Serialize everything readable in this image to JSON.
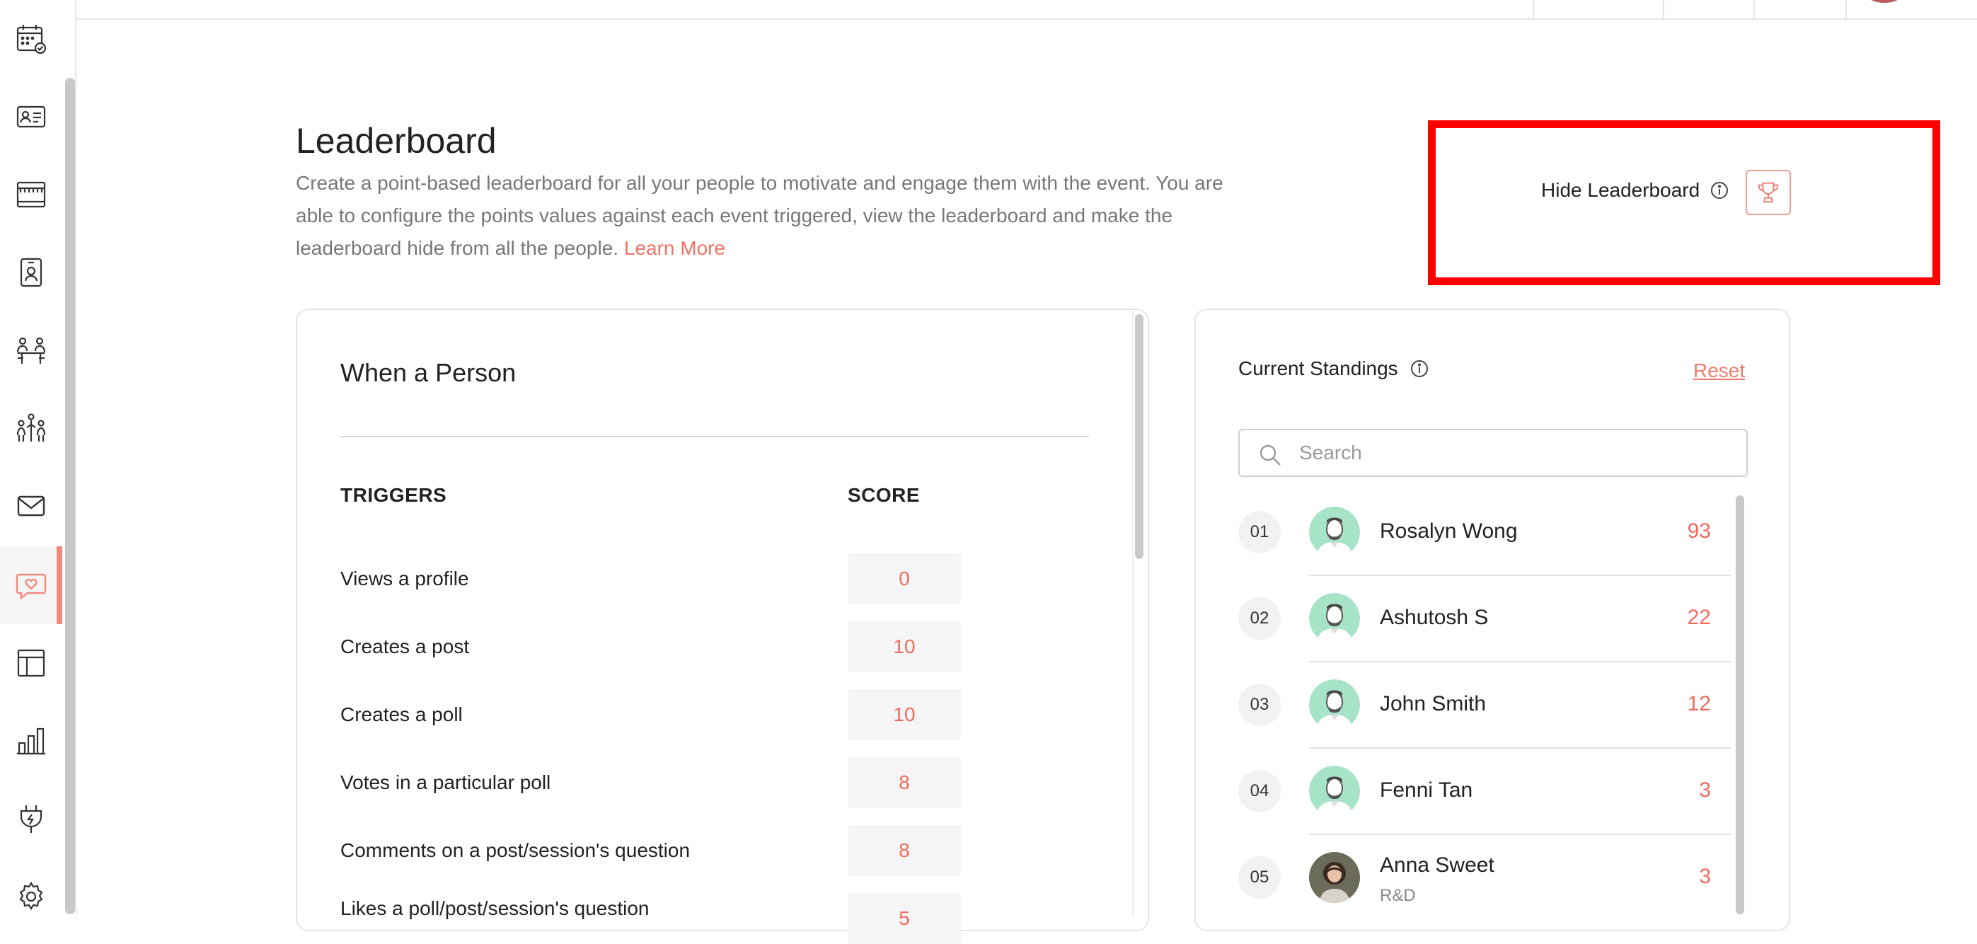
{
  "sidebar": {
    "items": [
      {
        "icon": "calendar-check-icon"
      },
      {
        "icon": "id-card-icon"
      },
      {
        "icon": "stage-icon"
      },
      {
        "icon": "badge-icon"
      },
      {
        "icon": "meeting-table-icon"
      },
      {
        "icon": "networking-people-icon"
      },
      {
        "icon": "mail-icon"
      },
      {
        "icon": "engagement-heart-icon",
        "active": true
      },
      {
        "icon": "layout-icon"
      },
      {
        "icon": "analytics-bar-icon"
      },
      {
        "icon": "integrations-plug-icon"
      },
      {
        "icon": "settings-gear-icon"
      }
    ],
    "accent": "#f08a7a"
  },
  "page": {
    "title": "Leaderboard",
    "description": "Create a point-based leaderboard for all your people to motivate and engage them with the event. You are able to configure the points values against each event triggered, view the leaderboard and make the leaderboard hide from all the people.",
    "learn_more": "Learn More"
  },
  "hide_leaderboard": {
    "label": "Hide Leaderboard",
    "icon": "trophy-icon",
    "highlight_color": "#ff0000"
  },
  "triggers_card": {
    "title": "When a Person",
    "col_triggers": "TRIGGERS",
    "col_score": "SCORE",
    "rows": [
      {
        "label": "Views a profile",
        "score": "0"
      },
      {
        "label": "Creates a post",
        "score": "10"
      },
      {
        "label": "Creates a poll",
        "score": "10"
      },
      {
        "label": "Votes in a particular poll",
        "score": "8"
      },
      {
        "label": "Comments on a post/session's question",
        "score": "8"
      },
      {
        "label": "Likes a poll/post/session's question",
        "score": "5"
      }
    ]
  },
  "standings": {
    "title": "Current Standings",
    "reset": "Reset",
    "search_placeholder": "Search",
    "people": [
      {
        "rank": "01",
        "name": "Rosalyn Wong",
        "sub": "",
        "score": "93",
        "avatar": "default"
      },
      {
        "rank": "02",
        "name": "Ashutosh S",
        "sub": "",
        "score": "22",
        "avatar": "default"
      },
      {
        "rank": "03",
        "name": "John Smith",
        "sub": "",
        "score": "12",
        "avatar": "default"
      },
      {
        "rank": "04",
        "name": "Fenni Tan",
        "sub": "",
        "score": "3",
        "avatar": "default"
      },
      {
        "rank": "05",
        "name": "Anna Sweet",
        "sub": "R&D",
        "score": "3",
        "avatar": "photo"
      }
    ],
    "score_color": "#ef6b5e"
  }
}
